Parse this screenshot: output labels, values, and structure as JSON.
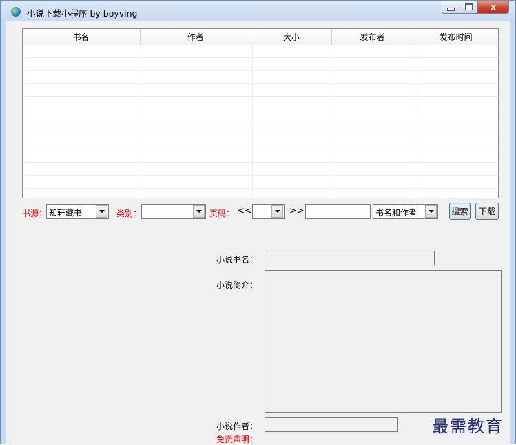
{
  "window": {
    "title": "小说下载小程序  by boyving"
  },
  "controls": {
    "close_label": "x"
  },
  "table": {
    "columns": [
      "书名",
      "作者",
      "大小",
      "发布者",
      "发布时间"
    ],
    "rows": []
  },
  "toolbar": {
    "source_label": "书源：",
    "source_value": "知轩藏书",
    "category_label": "类别：",
    "category_value": "",
    "page_label": "页码：",
    "prev_label": "<<",
    "page_value": "",
    "next_label": ">>",
    "search_value": "",
    "search_mode": "书名和作者",
    "search_button": "搜索",
    "download_button": "下载"
  },
  "details": {
    "name_label": "小说书名：",
    "name_value": "",
    "intro_label": "小说简介：",
    "intro_value": "",
    "author_label": "小说作者：",
    "author_value": "",
    "disclaimer_label": "免责声明："
  },
  "watermark": "最需教育"
}
